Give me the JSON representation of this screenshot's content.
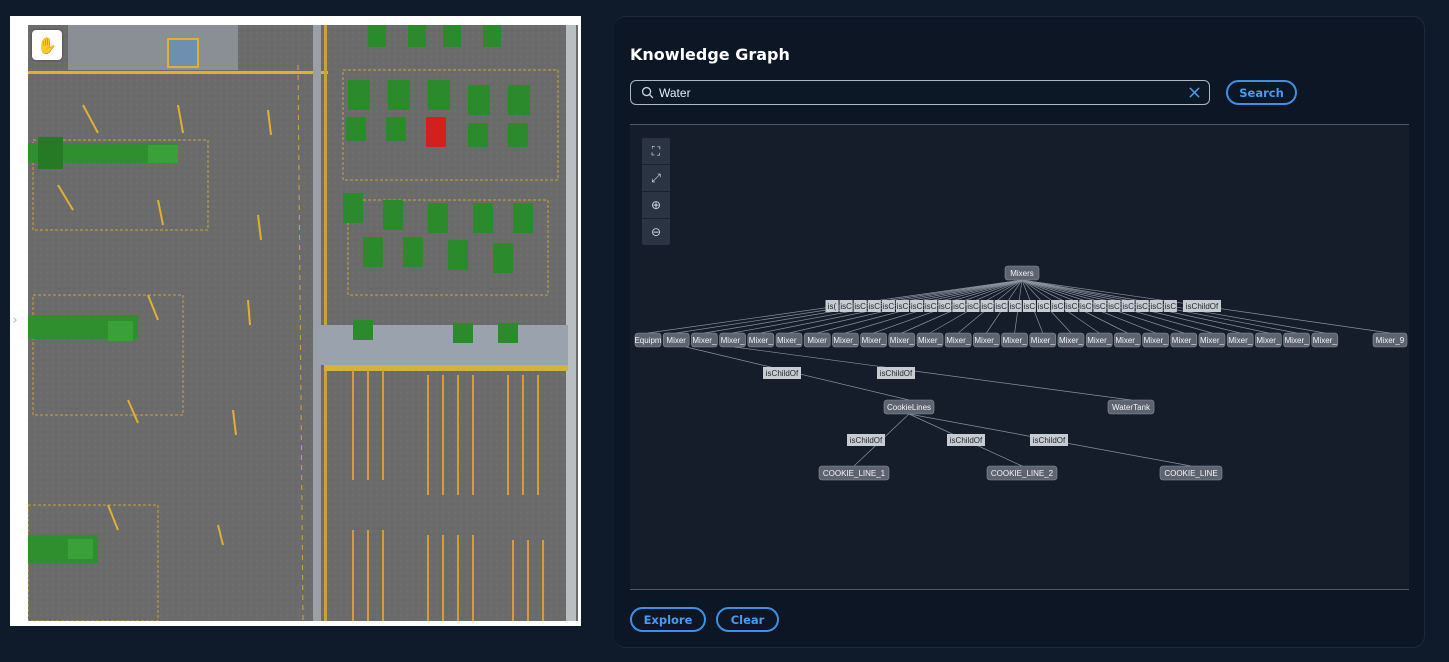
{
  "viewport": {
    "hand_tool_icon": "hand-icon",
    "collapse_icon": "chevron-right-icon",
    "collapse_glyph": "›"
  },
  "panel": {
    "title": "Knowledge Graph",
    "search": {
      "value": "Water",
      "search_icon": "search-icon",
      "clear_icon": "close-icon"
    },
    "buttons": {
      "search": "Search",
      "explore": "Explore",
      "clear": "Clear"
    },
    "toolbar": [
      {
        "name": "fit-view-icon",
        "glyph": "⛶"
      },
      {
        "name": "fullscreen-icon",
        "glyph": "⤢"
      },
      {
        "name": "zoom-in-icon",
        "glyph": "⊕"
      },
      {
        "name": "zoom-out-icon",
        "glyph": "⊖"
      }
    ]
  },
  "graph": {
    "root": "Mixers",
    "root_children": [
      "Equipm",
      "Mixer",
      "Mixer_",
      "Mixer_",
      "Mixer_",
      "Mixer_",
      "Mixer",
      "Mixer_",
      "Mixer_",
      "Mixer_",
      "Mixer_",
      "Mixer_",
      "Mixer_",
      "Mixer_",
      "Mixer_",
      "Mixer_",
      "Mixer_",
      "Mixer_",
      "Mixer_",
      "Mixer_",
      "Mixer_",
      "Mixer_",
      "Mixer_",
      "Mixer_",
      "Mixer_",
      "Mixer_9"
    ],
    "highlighted_child_index": 6,
    "highlight_color": "#4fb3ff",
    "root_edge_labels": [
      "is(",
      "isC",
      "isC",
      "isC",
      "isC",
      "isC",
      "isC",
      "isC",
      "isC",
      "isC",
      "isC",
      "isC",
      "isC",
      "isC",
      "isC",
      "isC",
      "isC",
      "isC",
      "isC",
      "isC",
      "isC",
      "isC",
      "isC",
      "isC",
      "isC",
      "isChildOf"
    ],
    "mid_edges": [
      {
        "label": "isChildOf"
      },
      {
        "label": "isChildOf"
      }
    ],
    "cookie_lines": "CookieLines",
    "water_tank": "WaterTank",
    "lines": [
      "COOKIE_LINE_1",
      "COOKIE_LINE_2",
      "COOKIE_LINE"
    ],
    "line_edge_labels": [
      "isChildOf",
      "isChildOf",
      "isChildOf"
    ]
  }
}
